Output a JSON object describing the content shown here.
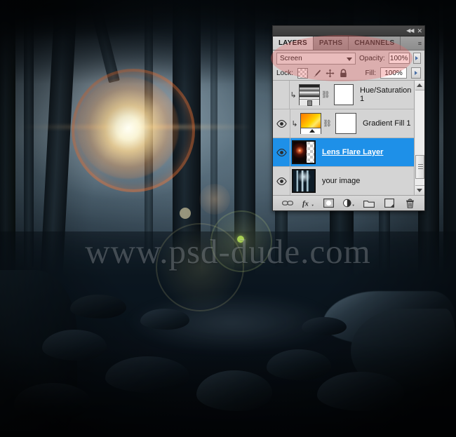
{
  "photo": {
    "watermark": "www.psd-dude.com",
    "scene_description": "misty forest with lens flare over rocky dark ravine"
  },
  "panel": {
    "titlebar": {
      "collapse_icon": "collapse-double-left-icon",
      "close_icon": "close-icon",
      "collapse_glyph": "◀◀",
      "close_glyph": "✕"
    },
    "tabs": [
      {
        "label": "LAYERS",
        "active": true
      },
      {
        "label": "PATHS",
        "active": false
      },
      {
        "label": "CHANNELS",
        "active": false
      }
    ],
    "tab_menu_glyph": "≡",
    "blend_mode": {
      "value": "Screen",
      "caret_icon": "chevron-down-icon"
    },
    "opacity": {
      "label": "Opacity:",
      "value": "100%"
    },
    "fill": {
      "label": "Fill:",
      "value": "100%"
    },
    "lock": {
      "label": "Lock:",
      "items": [
        "lock-transparent-pixels-icon",
        "lock-image-pixels-brush-icon",
        "lock-position-move-icon",
        "lock-all-padlock-icon"
      ]
    },
    "layers": [
      {
        "name": "Hue/Saturation 1",
        "visible": false,
        "selected": false,
        "clipped": true,
        "clip_glyph": "↳",
        "thumb_type": "hue-saturation-adjustment",
        "has_mask": true,
        "link_glyph": "⛓"
      },
      {
        "name": "Gradient Fill 1",
        "visible": true,
        "selected": false,
        "clipped": true,
        "clip_glyph": "↳",
        "thumb_type": "gradient-fill",
        "has_mask": true,
        "link_glyph": "⛓"
      },
      {
        "name": "Lens Flare Layer",
        "visible": true,
        "selected": true,
        "clipped": false,
        "clip_glyph": "",
        "thumb_type": "lens-flare-transparent",
        "has_mask": false,
        "link_glyph": ""
      },
      {
        "name": "your image",
        "visible": true,
        "selected": false,
        "clipped": false,
        "clip_glyph": "",
        "thumb_type": "forest-photo",
        "has_mask": false,
        "link_glyph": ""
      }
    ],
    "scrollbar": {
      "up_glyph": "",
      "down_glyph": ""
    },
    "footer_buttons": [
      {
        "name": "link-layers-button",
        "glyph": "⚯"
      },
      {
        "name": "layer-style-fx-button",
        "glyph": "fx"
      },
      {
        "name": "add-layer-mask-button",
        "glyph": "▣"
      },
      {
        "name": "new-fill-adjustment-layer-button",
        "glyph": "◐"
      },
      {
        "name": "new-group-button",
        "glyph": "▭"
      },
      {
        "name": "new-layer-button",
        "glyph": "❐"
      },
      {
        "name": "delete-layer-button",
        "glyph": "🗑"
      }
    ]
  },
  "colors": {
    "highlight": "#e96060",
    "selection_blue": "#1e90e8",
    "panel_gray": "#d4d4d4",
    "flare_orange": "#ff7632"
  }
}
